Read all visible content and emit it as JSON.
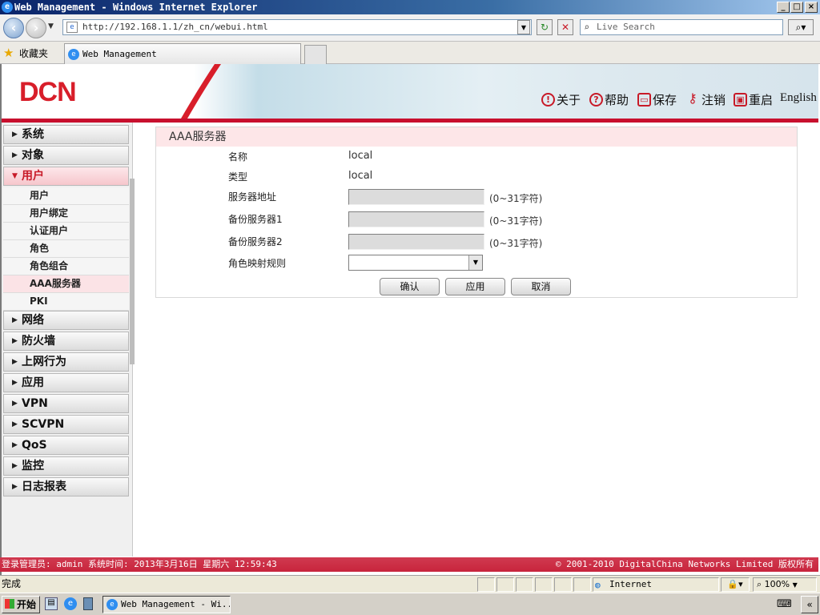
{
  "window": {
    "title": "Web Management - Windows Internet Explorer",
    "controls": [
      "_",
      "□",
      "×"
    ]
  },
  "browser": {
    "url": "http://192.168.1.1/zh_cn/webui.html",
    "search_placeholder": "Live Search",
    "favorites_label": "收藏夹",
    "tab_title": "Web Management"
  },
  "header": {
    "logo": "DCN",
    "nav": [
      {
        "label": "关于",
        "icon": "info-icon"
      },
      {
        "label": "帮助",
        "icon": "help-icon"
      },
      {
        "label": "保存",
        "icon": "save-icon"
      },
      {
        "label": "注销",
        "icon": "logout-key-icon"
      },
      {
        "label": "重启",
        "icon": "restart-icon"
      },
      {
        "label": "English"
      }
    ]
  },
  "sidebar": {
    "top_menus": [
      "系统",
      "对象"
    ],
    "active_menu": "用户",
    "user_submenu": [
      "用户",
      "用户绑定",
      "认证用户",
      "角色",
      "角色组合",
      "AAA服务器",
      "PKI"
    ],
    "selected_submenu": "AAA服务器",
    "bottom_menus": [
      "网络",
      "防火墙",
      "上网行为",
      "应用",
      "VPN",
      "SCVPN",
      "QoS",
      "监控",
      "日志报表"
    ]
  },
  "form": {
    "title": "AAA服务器",
    "name_label": "名称",
    "name_value": "local",
    "type_label": "类型",
    "type_value": "local",
    "server_addr_label": "服务器地址",
    "server_addr_value": "",
    "server_addr_hint": "(0~31字符)",
    "backup1_label": "备份服务器1",
    "backup1_value": "",
    "backup1_hint": "(0~31字符)",
    "backup2_label": "备份服务器2",
    "backup2_value": "",
    "backup2_hint": "(0~31字符)",
    "role_map_label": "角色映射规则",
    "role_map_value": "",
    "confirm_button": "确认",
    "apply_button": "应用",
    "cancel_button": "取消"
  },
  "footer": {
    "login_info": "登录管理员: admin 系统时间: 2013年3月16日 星期六 12:59:43",
    "copyright": "© 2001-2010 DigitalChina Networks Limited 版权所有"
  },
  "statusbar": {
    "status": "完成",
    "zone": "Internet",
    "zoom": "100%"
  },
  "taskbar": {
    "start": "开始",
    "task": "Web Management - Wi..."
  },
  "colors": {
    "brand_red": "#c8102e",
    "active_pink": "#fde6e8"
  }
}
